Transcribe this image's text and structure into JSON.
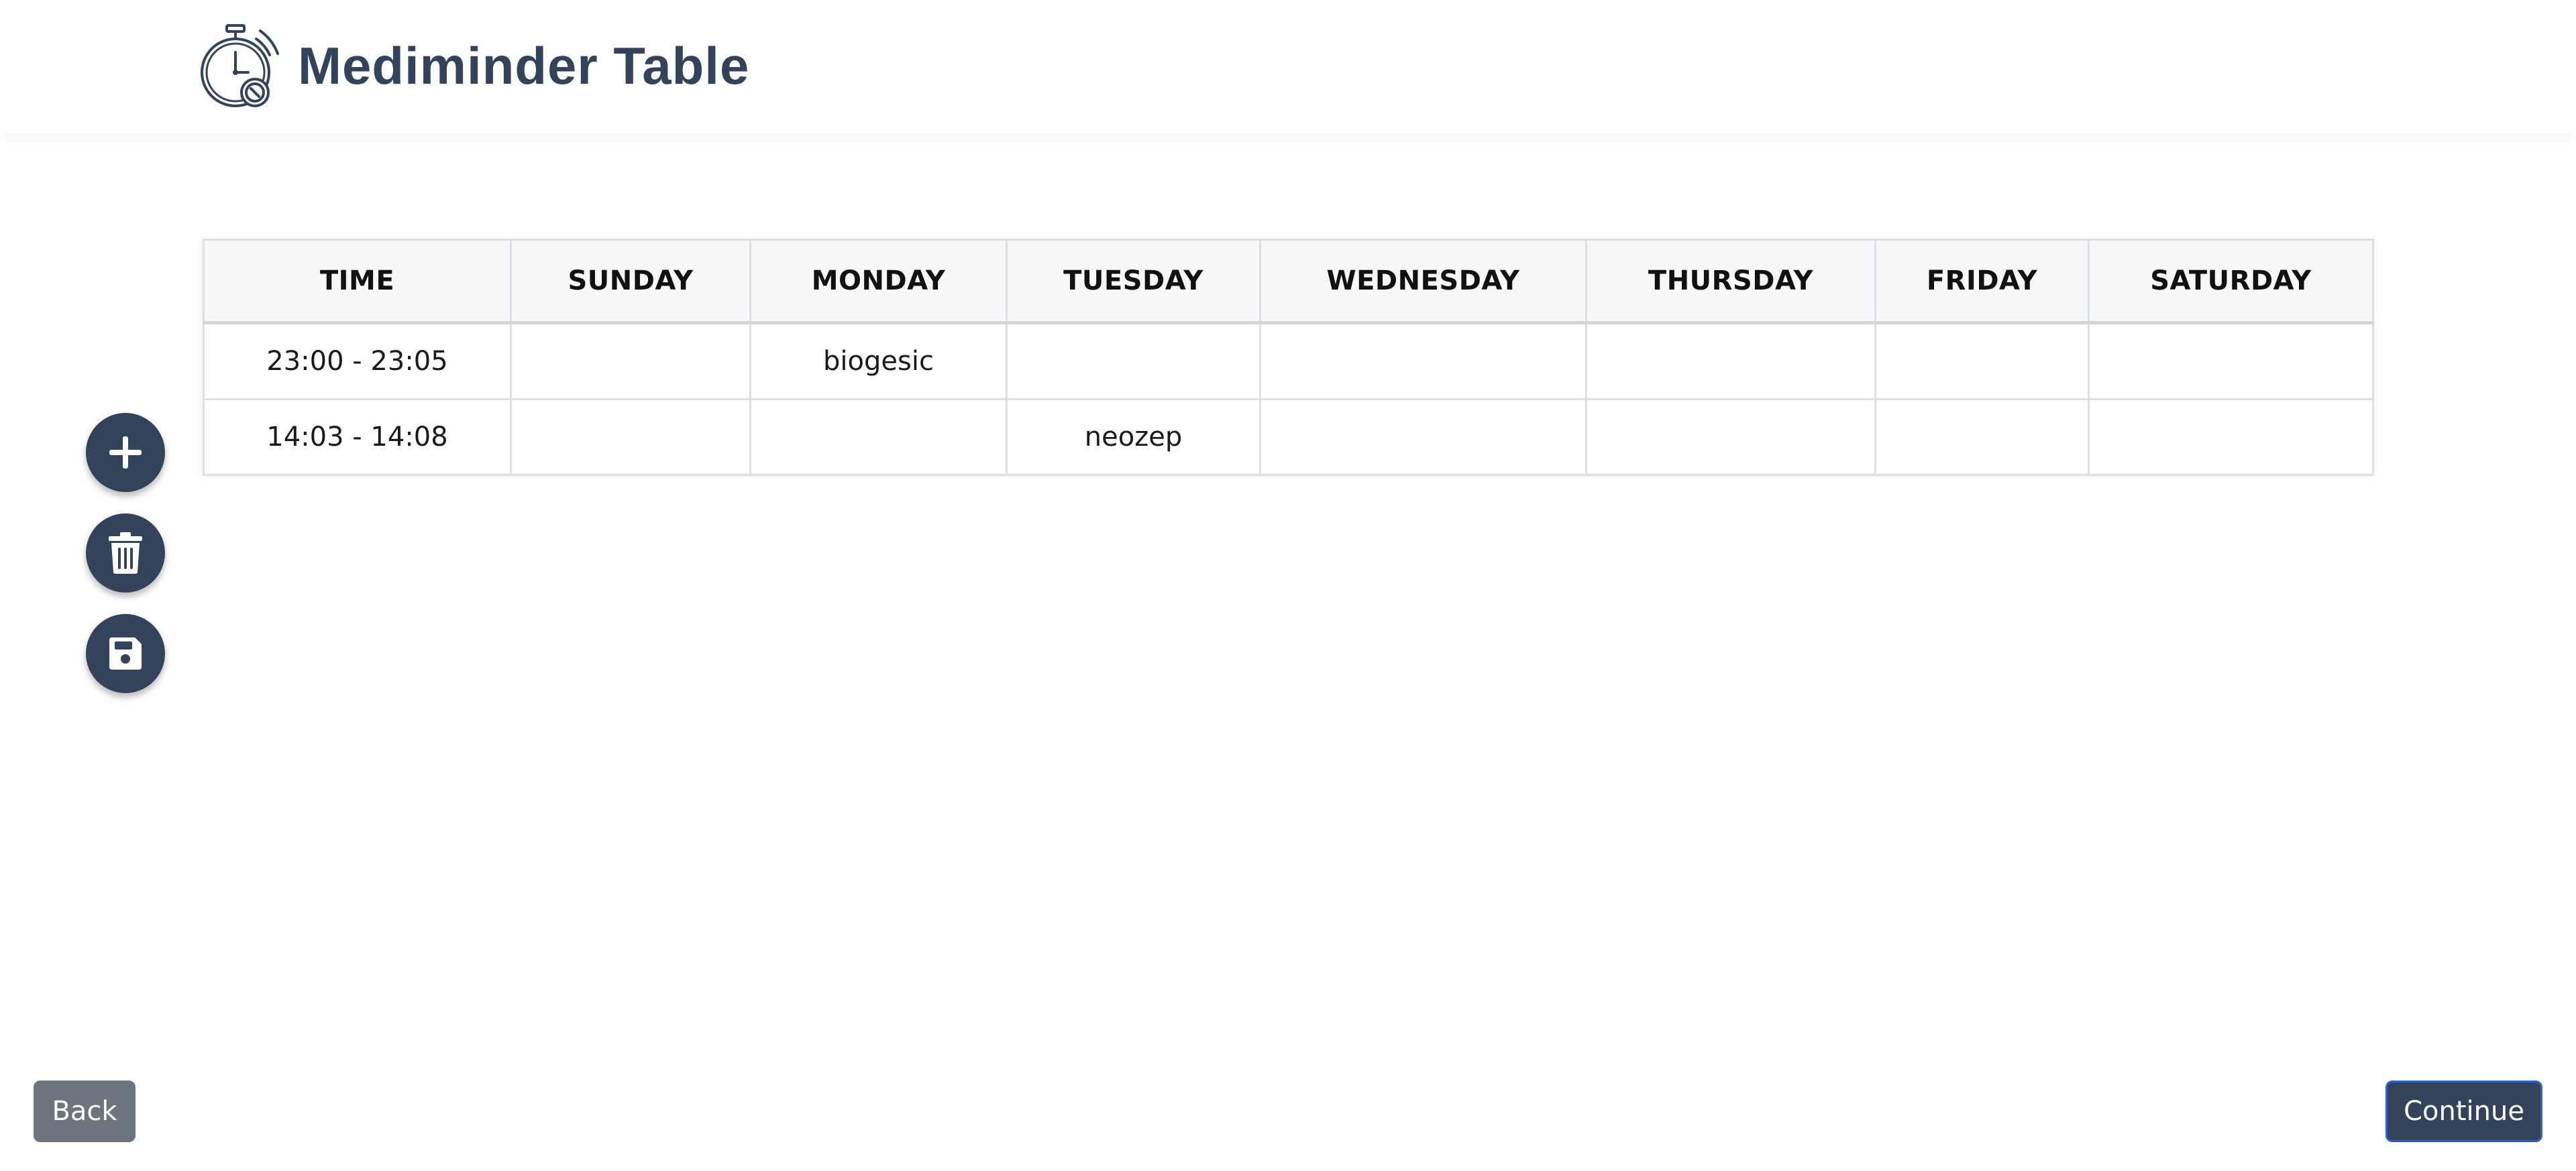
{
  "header": {
    "title": "Mediminder Table",
    "logo_icon": "stopwatch-pill-icon"
  },
  "table": {
    "columns": [
      "TIME",
      "SUNDAY",
      "MONDAY",
      "TUESDAY",
      "WEDNESDAY",
      "THURSDAY",
      "FRIDAY",
      "SATURDAY"
    ],
    "rows": [
      [
        "23:00 - 23:05",
        "",
        "biogesic",
        "",
        "",
        "",
        "",
        ""
      ],
      [
        "14:03 - 14:08",
        "",
        "",
        "neozep",
        "",
        "",
        "",
        ""
      ]
    ]
  },
  "actions": {
    "add_icon": "plus-icon",
    "delete_icon": "trash-icon",
    "save_icon": "floppy-disk-icon"
  },
  "footer": {
    "back_label": "Back",
    "continue_label": "Continue"
  },
  "colors": {
    "primary": "#33435c",
    "secondary": "#6c757d",
    "header_bg": "#f6f7f9",
    "border": "#dcdfe3"
  }
}
